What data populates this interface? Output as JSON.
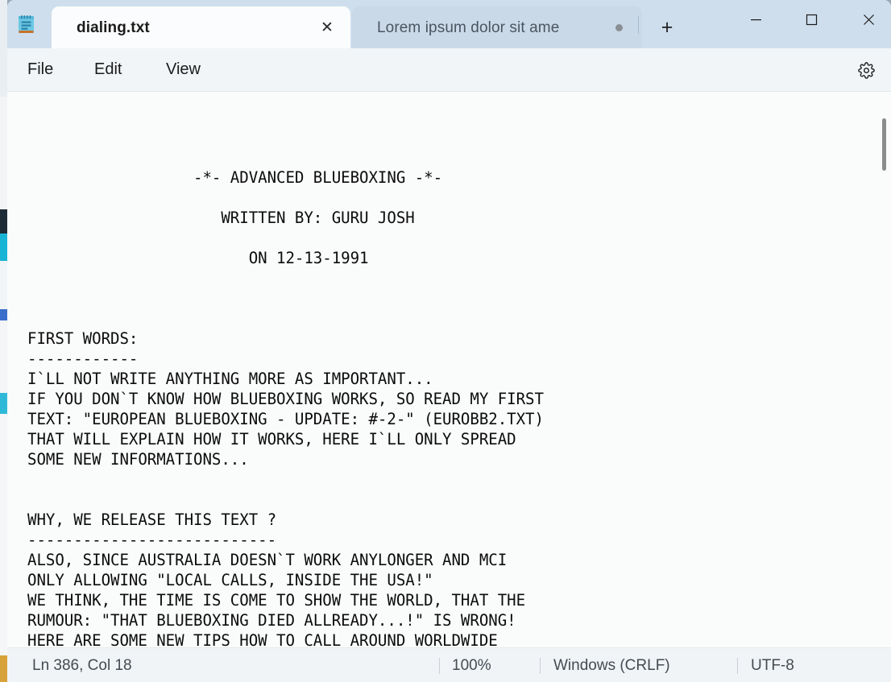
{
  "window": {
    "app_icon": "notepad-icon",
    "controls": {
      "minimize": "–",
      "maximize": "☐",
      "close": "✕"
    }
  },
  "tabs": [
    {
      "label": "dialing.txt",
      "active": true,
      "close_glyph": "✕",
      "modified": false
    },
    {
      "label": "Lorem ipsum dolor sit ame",
      "active": false,
      "close_glyph": "",
      "modified": true
    }
  ],
  "newtab": {
    "glyph": "+",
    "label": "New tab"
  },
  "menubar": {
    "items": [
      {
        "label": "File"
      },
      {
        "label": "Edit"
      },
      {
        "label": "View"
      }
    ],
    "settings_label": "Settings"
  },
  "editor": {
    "content": "\n\n\n                  -*- ADVANCED BLUEBOXING -*-\n\n                     WRITTEN BY: GURU JOSH\n\n                        ON 12-13-1991\n\n\n\nFIRST WORDS:\n------------\nI`LL NOT WRITE ANYTHING MORE AS IMPORTANT...\nIF YOU DON`T KNOW HOW BLUEBOXING WORKS, SO READ MY FIRST\nTEXT: \"EUROPEAN BLUEBOXING - UPDATE: #-2-\" (EUROBB2.TXT)\nTHAT WILL EXPLAIN HOW IT WORKS, HERE I`LL ONLY SPREAD\nSOME NEW INFORMATIONS...\n\n\nWHY, WE RELEASE THIS TEXT ?\n---------------------------\nALSO, SINCE AUSTRALIA DOESN`T WORK ANYLONGER AND MCI\nONLY ALLOWING \"LOCAL CALLS, INSIDE THE USA!\"\nWE THINK, THE TIME IS COME TO SHOW THE WORLD, THAT THE\nRUMOUR: \"THAT BLUEBOXING DIED ALLREADY...!\" IS WRONG!\nHERE ARE SOME NEW TIPS HOW TO CALL AROUND WORLDWIDE"
  },
  "statusbar": {
    "line_col": "Ln 386, Col 18",
    "zoom": "100%",
    "line_endings": "Windows (CRLF)",
    "encoding": "UTF-8"
  },
  "colors": {
    "titlebar": "#cedeec",
    "active_tab": "#fbfcfd",
    "inactive_tab": "#cad9e7",
    "menubar": "#f1f5f8",
    "editor_bg": "#fafbfb",
    "statusbar": "#f1f4f7",
    "text": "#0c0c0c"
  }
}
